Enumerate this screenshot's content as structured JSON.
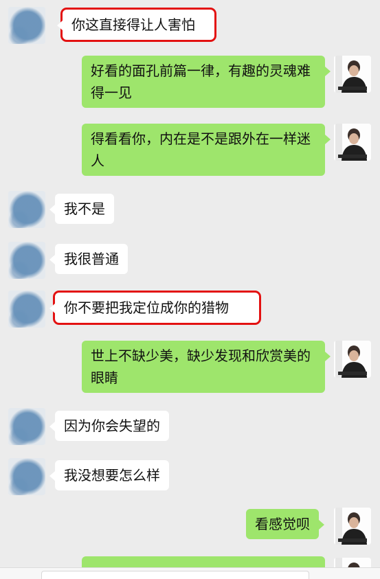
{
  "messages": [
    {
      "side": "left",
      "text": "你这直接得让人害怕",
      "highlighted": true
    },
    {
      "side": "right",
      "text": "好看的面孔前篇一律，有趣的灵魂难得一见"
    },
    {
      "side": "right",
      "text": "得看看你，内在是不是跟外在一样迷人"
    },
    {
      "side": "left",
      "text": "我不是"
    },
    {
      "side": "left",
      "text": "我很普通"
    },
    {
      "side": "left",
      "text": "你不要把我定位成你的猎物",
      "highlighted": true
    },
    {
      "side": "right",
      "text": "世上不缺少美，缺少发现和欣赏美的眼睛"
    },
    {
      "side": "left",
      "text": "因为你会失望的"
    },
    {
      "side": "left",
      "text": "我没想要怎么样"
    },
    {
      "side": "right",
      "text": "看感觉呗"
    },
    {
      "side": "right",
      "text": ""
    }
  ],
  "colors": {
    "background": "#ececec",
    "sent_bubble": "#9ee56c",
    "received_bubble": "#ffffff",
    "highlight_box": "#e31111"
  },
  "icons": {
    "left_avatar": "blurred-profile-photo",
    "right_avatar": "man-in-black-shirt-photo"
  }
}
